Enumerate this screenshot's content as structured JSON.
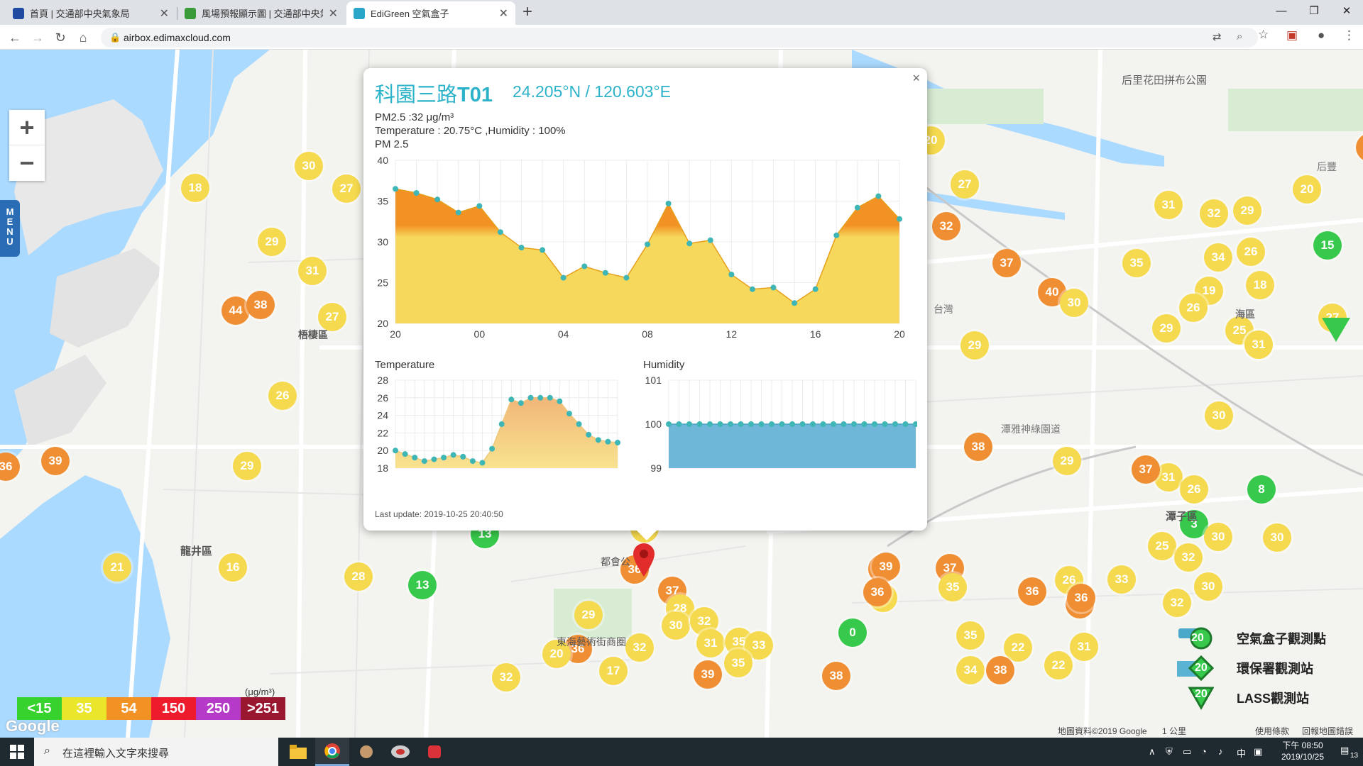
{
  "browser": {
    "tabs": [
      {
        "label": "首頁 | 交通部中央氣象局",
        "favicon_color": "#1f4aa0"
      },
      {
        "label": "風場預報顯示圖 | 交通部中央氣象局",
        "favicon_color": "#3a9a3a"
      },
      {
        "label": "EdiGreen 空氣盒子",
        "favicon_color": "#2aa6c8",
        "active": true
      }
    ],
    "url": "airbox.edimaxcloud.com"
  },
  "map": {
    "menu_label": "MENU",
    "zoom_in": "+",
    "zoom_out": "−",
    "markers": [
      {
        "v": "30",
        "c": "y"
      },
      {
        "v": "18",
        "c": "y"
      },
      {
        "v": "27",
        "c": "y"
      },
      {
        "v": "29",
        "c": "y"
      },
      {
        "v": "31",
        "c": "y"
      },
      {
        "v": "44",
        "c": "o"
      },
      {
        "v": "38",
        "c": "o"
      },
      {
        "v": "27",
        "c": "y"
      },
      {
        "v": "26",
        "c": "y"
      },
      {
        "v": "39",
        "c": "o"
      },
      {
        "v": "36",
        "c": "o"
      },
      {
        "v": "29",
        "c": "y"
      },
      {
        "v": "21",
        "c": "y"
      },
      {
        "v": "16",
        "c": "y"
      },
      {
        "v": "28",
        "c": "y"
      },
      {
        "v": "13",
        "c": "g"
      },
      {
        "v": "13",
        "c": "g"
      },
      {
        "v": "36",
        "c": "o"
      },
      {
        "v": "19",
        "c": "y"
      },
      {
        "v": "32",
        "c": "y"
      },
      {
        "v": "37",
        "c": "o"
      },
      {
        "v": "29",
        "c": "y"
      },
      {
        "v": "28",
        "c": "y"
      },
      {
        "v": "30",
        "c": "y"
      },
      {
        "v": "32",
        "c": "y"
      },
      {
        "v": "36",
        "c": "o"
      },
      {
        "v": "32",
        "c": "y"
      },
      {
        "v": "31",
        "c": "y"
      },
      {
        "v": "35",
        "c": "y"
      },
      {
        "v": "33",
        "c": "y"
      },
      {
        "v": "35",
        "c": "y"
      },
      {
        "v": "17",
        "c": "y"
      },
      {
        "v": "39",
        "c": "o"
      },
      {
        "v": "32",
        "c": "y"
      },
      {
        "v": "20",
        "c": "y"
      },
      {
        "v": "38",
        "c": "o"
      },
      {
        "v": "0",
        "c": "g"
      },
      {
        "v": "39",
        "c": "o"
      },
      {
        "v": "24",
        "c": "y"
      },
      {
        "v": "37",
        "c": "o"
      },
      {
        "v": "35",
        "c": "y"
      },
      {
        "v": "36",
        "c": "o"
      },
      {
        "v": "39",
        "c": "o"
      },
      {
        "v": "35",
        "c": "y"
      },
      {
        "v": "22",
        "c": "y"
      },
      {
        "v": "34",
        "c": "y"
      },
      {
        "v": "38",
        "c": "o"
      },
      {
        "v": "26",
        "c": "y"
      },
      {
        "v": "36",
        "c": "o"
      },
      {
        "v": "36",
        "c": "o"
      },
      {
        "v": "33",
        "c": "y"
      },
      {
        "v": "31",
        "c": "y"
      },
      {
        "v": "22",
        "c": "y"
      },
      {
        "v": "32",
        "c": "y"
      },
      {
        "v": "30",
        "c": "y"
      },
      {
        "v": "25",
        "c": "y"
      },
      {
        "v": "32",
        "c": "y"
      },
      {
        "v": "3",
        "c": "g"
      },
      {
        "v": "31",
        "c": "y"
      },
      {
        "v": "26",
        "c": "y"
      },
      {
        "v": "37",
        "c": "o"
      },
      {
        "v": "8",
        "c": "g"
      },
      {
        "v": "29",
        "c": "y"
      },
      {
        "v": "38",
        "c": "o"
      },
      {
        "v": "30",
        "c": "y"
      },
      {
        "v": "29",
        "c": "y"
      },
      {
        "v": "37",
        "c": "o"
      },
      {
        "v": "40",
        "c": "o"
      },
      {
        "v": "30",
        "c": "y"
      },
      {
        "v": "35",
        "c": "y"
      },
      {
        "v": "32",
        "c": "o"
      },
      {
        "v": "27",
        "c": "y"
      },
      {
        "v": "31",
        "c": "y"
      },
      {
        "v": "32",
        "c": "y"
      },
      {
        "v": "29",
        "c": "y"
      },
      {
        "v": "20",
        "c": "y"
      },
      {
        "v": "34",
        "c": "y"
      },
      {
        "v": "26",
        "c": "y"
      },
      {
        "v": "18",
        "c": "y"
      },
      {
        "v": "19",
        "c": "y"
      },
      {
        "v": "26",
        "c": "y"
      },
      {
        "v": "25",
        "c": "y"
      },
      {
        "v": "31",
        "c": "y"
      },
      {
        "v": "29",
        "c": "y"
      },
      {
        "v": "31",
        "c": "y"
      },
      {
        "v": "15",
        "c": "g"
      },
      {
        "v": "27",
        "c": "y"
      },
      {
        "v": "30",
        "c": "y"
      },
      {
        "v": "30",
        "c": "y"
      },
      {
        "v": "20",
        "c": "y"
      },
      {
        "v": "39",
        "c": "o"
      },
      {
        "v": "36",
        "c": "o"
      }
    ],
    "places": [
      "梧棲區",
      "龍井區",
      "潭子區",
      "東海藝術街商圈",
      "都會公",
      "后里花田拼布公園",
      "台灣",
      "潭雅神綠園道",
      "后豐",
      "海區"
    ]
  },
  "popup": {
    "close": "×",
    "station_prefix": "科園三路",
    "station_id": "T01",
    "coordinates": "24.205°N / 120.603°E",
    "pm25_line": "PM2.5 :32 μg/m³",
    "temp_hum_line": "Temperature : 20.75°C ,Humidity : 100%",
    "pm25_title": "PM 2.5",
    "temperature_title": "Temperature",
    "humidity_title": "Humidity",
    "last_update": "Last update: 2019-10-25 20:40:50"
  },
  "chart_data": [
    {
      "type": "area",
      "title": "PM 2.5",
      "ylim": [
        20,
        40
      ],
      "yticks": [
        "40",
        "35",
        "30",
        "25",
        "20"
      ],
      "xticks": [
        "20",
        "00",
        "04",
        "08",
        "12",
        "16",
        "20"
      ],
      "threshold": 34,
      "values": [
        36.5,
        36,
        35.2,
        33.6,
        34.4,
        31.2,
        29.3,
        29,
        25.6,
        27,
        26.2,
        25.6,
        29.7,
        34.7,
        29.8,
        30.2,
        26,
        24.2,
        24.4,
        22.5,
        24.2,
        30.8,
        34.2,
        35.6,
        32.8
      ]
    },
    {
      "type": "area",
      "title": "Temperature",
      "ylim": [
        18,
        28
      ],
      "yticks": [
        "28",
        "26",
        "24",
        "22",
        "20",
        "18"
      ],
      "values": [
        20.0,
        19.6,
        19.2,
        18.8,
        19.0,
        19.2,
        19.5,
        19.3,
        18.8,
        18.6,
        20.2,
        23.0,
        25.8,
        25.4,
        26.0,
        26.0,
        26.0,
        25.6,
        24.2,
        23.0,
        21.8,
        21.2,
        21.0,
        20.9
      ]
    },
    {
      "type": "area",
      "title": "Humidity",
      "ylim": [
        99,
        101
      ],
      "yticks": [
        "101",
        "100",
        "99"
      ],
      "values": [
        100,
        100,
        100,
        100,
        100,
        100,
        100,
        100,
        100,
        100,
        100,
        100,
        100,
        100,
        100,
        100,
        100,
        100,
        100,
        100,
        100,
        100,
        100,
        100,
        100
      ]
    }
  ],
  "aqi_scale": {
    "items": [
      {
        "label": "<15",
        "color": "#37d22e"
      },
      {
        "label": "35",
        "color": "#e9e62b"
      },
      {
        "label": "54",
        "color": "#f29124"
      },
      {
        "label": "150",
        "color": "#ee1b2c"
      },
      {
        "label": "250",
        "color": "#b63ac8"
      },
      {
        "label": ">251",
        "color": "#9a1730"
      }
    ],
    "unit": "(μg/m³)"
  },
  "legend": {
    "airbox": "空氣盒子觀測點",
    "epa": "環保署觀測站",
    "lass": "LASS觀測站",
    "sample_value": "20"
  },
  "attribution": {
    "mapdata": "地圖資料©2019 Google",
    "scale": "1 公里",
    "terms": "使用條款",
    "report": "回報地圖錯誤",
    "google": "Google"
  },
  "taskbar": {
    "search_placeholder": "在這裡輸入文字來搜尋",
    "ime": "中",
    "time": "下午 08:50",
    "date": "2019/10/25",
    "notifications": "13"
  }
}
